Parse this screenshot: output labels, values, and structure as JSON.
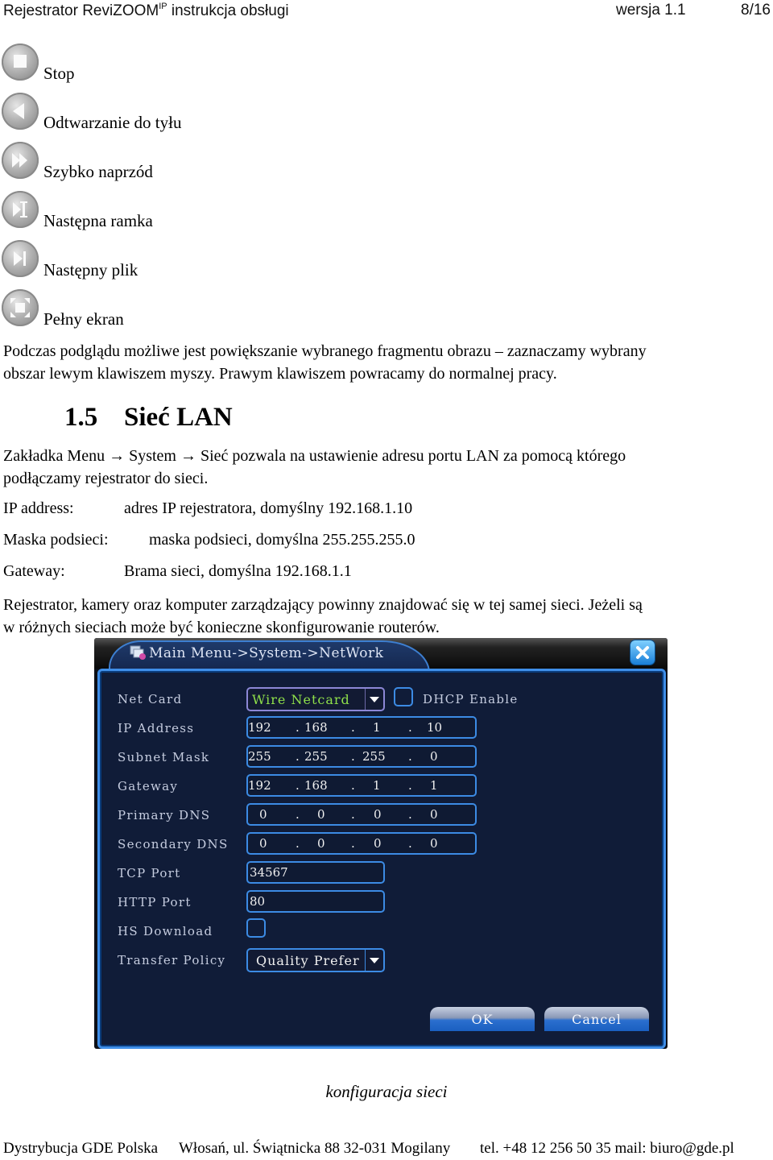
{
  "header": {
    "title_main": "Rejestrator ReviZOOM",
    "title_sup": "IP",
    "title_rest": " instrukcja obsługi",
    "version": "wersja 1.1",
    "page": "8/16"
  },
  "controls": [
    {
      "icon": "stop-icon",
      "label": "Stop"
    },
    {
      "icon": "play-backward-icon",
      "label": "Odtwarzanie do tyłu"
    },
    {
      "icon": "fast-forward-icon",
      "label": "Szybko naprzód"
    },
    {
      "icon": "next-frame-icon",
      "label": "Następna ramka"
    },
    {
      "icon": "next-file-icon",
      "label": "Następny plik"
    },
    {
      "icon": "fullscreen-icon",
      "label": "Pełny ekran"
    }
  ],
  "zoom_paragraph": {
    "line1": "Podczas podglądu możliwe jest powiększanie wybranego fragmentu obrazu – zaznaczamy wybrany",
    "line2": "obszar lewym klawiszem myszy. Prawym klawiszem powracamy do normalnej pracy."
  },
  "section": {
    "number": "1.5",
    "title": "Sieć LAN"
  },
  "intro": {
    "line1": "Zakładka Menu → System → Sieć pozwala na ustawienie adresu portu LAN za pomocą którego",
    "line2": "podłączamy rejestrator do sieci."
  },
  "definitions": [
    {
      "term": "IP address:",
      "desc": "adres IP rejestratora, domyślny 192.168.1.10"
    },
    {
      "term": "Maska podsieci:",
      "desc": "maska podsieci, domyślna 255.255.255.0"
    },
    {
      "term": "Gateway:",
      "desc": "Brama sieci, domyślna 192.168.1.1"
    }
  ],
  "note": {
    "line1": "Rejestrator, kamery oraz komputer zarządzający powinny znajdować się w tej samej sieci. Jeżeli są",
    "line2": "w różnych sieciach może być konieczne skonfigurowanie routerów."
  },
  "dialog": {
    "title": "Main Menu->System->NetWork",
    "net_card": {
      "label": "Net Card",
      "value": "Wire Netcard",
      "value_color": "#8fe04a"
    },
    "dhcp": {
      "label": "DHCP Enable",
      "checked": false
    },
    "ip_address": {
      "label": "IP Address",
      "octets": [
        "192",
        "168",
        "1",
        "10"
      ]
    },
    "subnet_mask": {
      "label": "Subnet Mask",
      "octets": [
        "255",
        "255",
        "255",
        "0"
      ]
    },
    "gateway": {
      "label": "Gateway",
      "octets": [
        "192",
        "168",
        "1",
        "1"
      ]
    },
    "primary_dns": {
      "label": "Primary DNS",
      "octets": [
        "0",
        "0",
        "0",
        "0"
      ]
    },
    "secondary_dns": {
      "label": "Secondary DNS",
      "octets": [
        "0",
        "0",
        "0",
        "0"
      ]
    },
    "tcp_port": {
      "label": "TCP Port",
      "value": "34567"
    },
    "http_port": {
      "label": "HTTP Port",
      "value": "80"
    },
    "hs_download": {
      "label": "HS Download",
      "checked": false
    },
    "transfer_policy": {
      "label": "Transfer Policy",
      "value": "Quality Prefer"
    },
    "ok_label": "OK",
    "cancel_label": "Cancel",
    "accent_color": "#3c8be4",
    "body_color": "#101c38"
  },
  "caption": "konfiguracja sieci",
  "footer": {
    "company": "Dystrybucja GDE Polska",
    "address": "Włosań, ul. Świątnicka 88 32-031 Mogilany",
    "contact": "tel. +48 12 256 50 35 mail: biuro@gde.pl"
  }
}
